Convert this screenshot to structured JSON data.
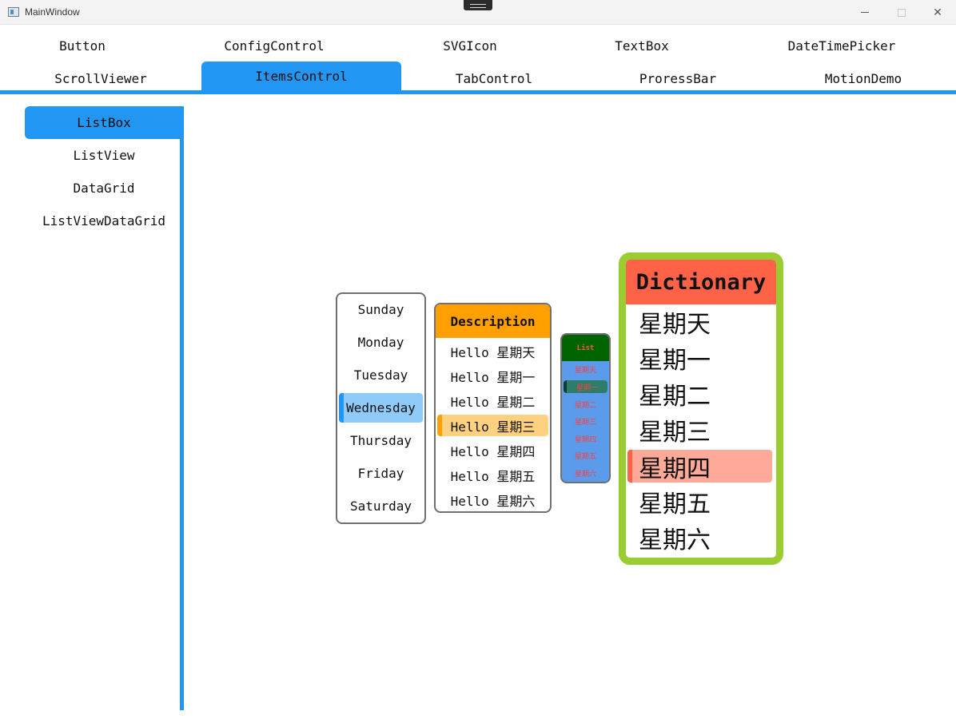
{
  "window": {
    "title": "MainWindow",
    "controls": {
      "minimize": "minimize",
      "maximize": "maximize",
      "close": "✕"
    }
  },
  "tabs": [
    {
      "label": "Button"
    },
    {
      "label": "ConfigControl"
    },
    {
      "label": "SVGIcon"
    },
    {
      "label": "TextBox"
    },
    {
      "label": "DateTimePicker"
    },
    {
      "label": "ScrollViewer"
    },
    {
      "label": "ItemsControl",
      "selected": true
    },
    {
      "label": "TabControl"
    },
    {
      "label": "ProressBar"
    },
    {
      "label": "MotionDemo"
    }
  ],
  "sidebar": {
    "items": [
      {
        "label": "ListBox",
        "selected": true
      },
      {
        "label": "ListView"
      },
      {
        "label": "DataGrid"
      },
      {
        "label": "ListViewDataGrid"
      }
    ]
  },
  "days_list": {
    "items": [
      "Sunday",
      "Monday",
      "Tuesday",
      "Wednesday",
      "Thursday",
      "Friday",
      "Saturday"
    ],
    "selected": "Wednesday"
  },
  "description_list": {
    "header": "Description",
    "items": [
      "Hello 星期天",
      "Hello 星期一",
      "Hello 星期二",
      "Hello 星期三",
      "Hello 星期四",
      "Hello 星期五",
      "Hello 星期六"
    ],
    "selected": "Hello 星期三"
  },
  "small_list": {
    "header": "List",
    "items": [
      "星期天",
      "星期一",
      "星期二",
      "星期三",
      "星期四",
      "星期五",
      "星期六"
    ],
    "selected": "星期一"
  },
  "dictionary_list": {
    "header": "Dictionary",
    "items": [
      "星期天",
      "星期一",
      "星期二",
      "星期三",
      "星期四",
      "星期五",
      "星期六"
    ],
    "selected": "星期四"
  },
  "colors": {
    "accent": "#2196f3",
    "days_selected": "#90caf9",
    "description_header": "#ffa000",
    "description_selected": "#ffd180",
    "small_header": "#006400",
    "small_background": "#5b9bec",
    "small_text": "#ff3d3d",
    "dictionary_border": "#9acd32",
    "dictionary_header": "#ff6347",
    "dictionary_selected": "#ffaa99"
  }
}
